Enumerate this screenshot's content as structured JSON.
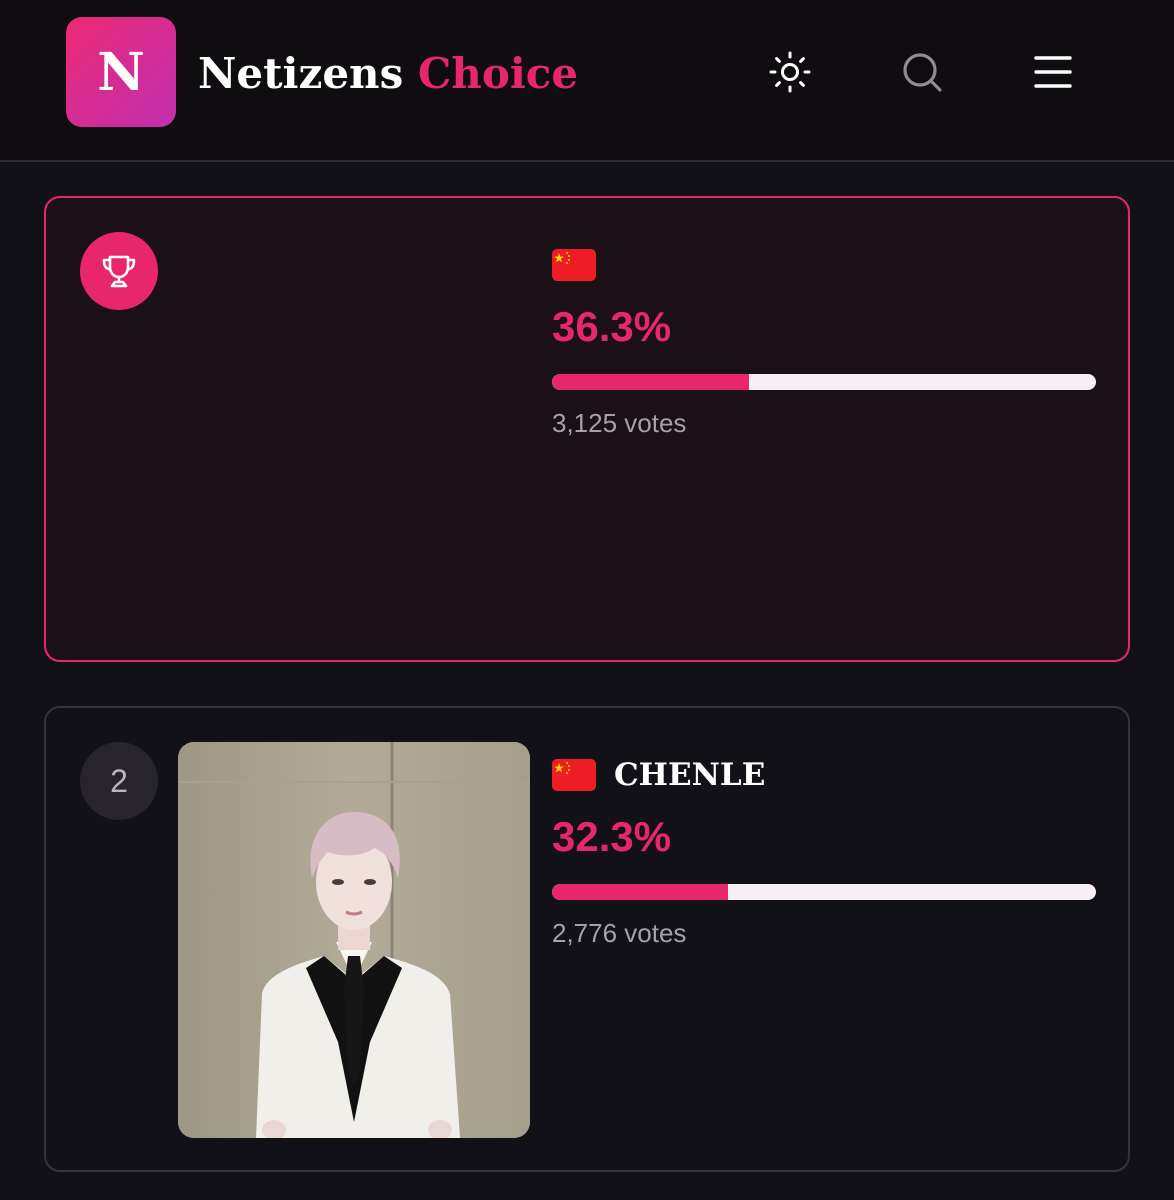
{
  "header": {
    "logo_letter": "N",
    "brand_part1": "Netizens",
    "brand_part2": "Choice",
    "icons": [
      "sun-icon",
      "search-icon",
      "menu-icon"
    ]
  },
  "colors": {
    "accent": "#e8276b",
    "background": "#121117",
    "header_bg": "#0f0d10",
    "bar_track": "#f6eff3"
  },
  "results": [
    {
      "rank_icon": "trophy-icon",
      "flag": "china-flag",
      "name": "",
      "percent_label": "36.3%",
      "percent": 36.3,
      "votes_label": "3,125 votes"
    },
    {
      "rank": "2",
      "flag": "china-flag",
      "name": "CHENLE",
      "percent_label": "32.3%",
      "percent": 32.3,
      "votes_label": "2,776 votes"
    }
  ]
}
